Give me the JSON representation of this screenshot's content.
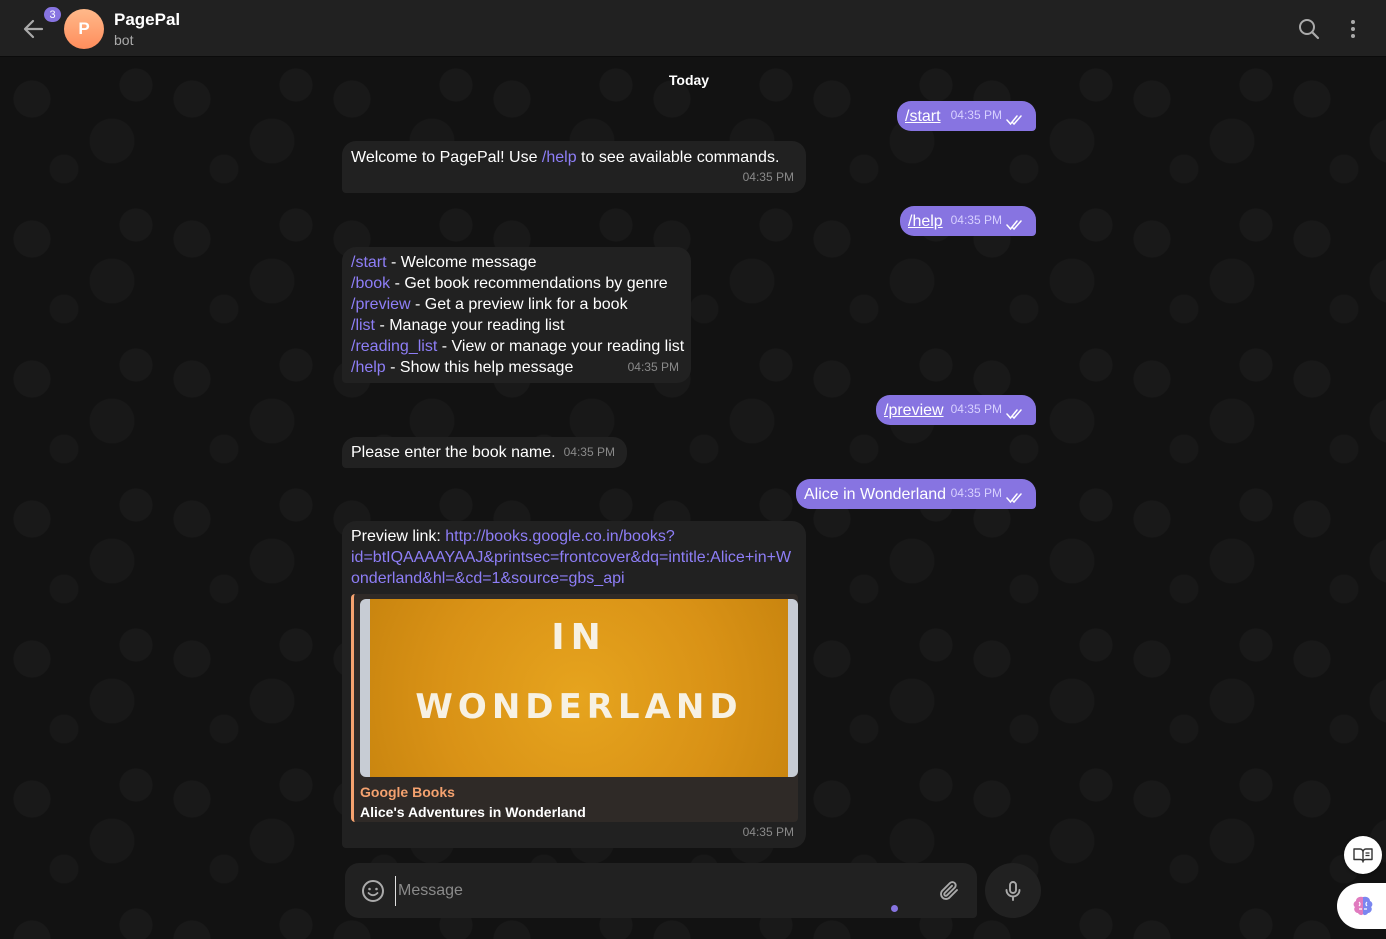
{
  "header": {
    "unread_count": "3",
    "avatar_letter": "P",
    "title": "PagePal",
    "status": "bot"
  },
  "date_separator": "Today",
  "messages": [
    {
      "direction": "out",
      "text": "/start",
      "time": "04:35 PM"
    },
    {
      "direction": "in",
      "prefix": "Welcome to PagePal! Use ",
      "link": "/help",
      "suffix": " to see available commands.",
      "time": "04:35 PM"
    },
    {
      "direction": "out",
      "text": "/help",
      "time": "04:35 PM"
    },
    {
      "direction": "in",
      "help_lines": [
        {
          "cmd": "/start",
          "desc": " - Welcome message"
        },
        {
          "cmd": "/book",
          "desc": " - Get book recommendations by genre"
        },
        {
          "cmd": "/preview",
          "desc": " - Get a preview link for a book"
        },
        {
          "cmd": "/list",
          "desc": " - Manage your reading list"
        },
        {
          "cmd": "/reading_list",
          "desc": " - View or manage your reading list"
        },
        {
          "cmd": "/help",
          "desc": " - Show this help message"
        }
      ],
      "time": "04:35 PM"
    },
    {
      "direction": "out",
      "text": "/preview",
      "time": "04:35 PM"
    },
    {
      "direction": "in",
      "text": "Please enter the book name.",
      "time": "04:35 PM"
    },
    {
      "direction": "out",
      "text": "Alice in Wonderland",
      "time": "04:35 PM"
    },
    {
      "direction": "in",
      "label": "Preview link: ",
      "url_line1": "http://books.google.co.in/books?",
      "url_line2": "id=btIQAAAAYAAJ&printsec=frontcover&dq=intitle:Alice+in+W",
      "url_line3": "onderland&hl=&cd=1&source=gbs_api",
      "preview": {
        "image_line1": "IN",
        "image_line2": "WONDERLAND",
        "site": "Google Books",
        "title": "Alice's Adventures in Wonderland"
      },
      "time": "04:35 PM"
    }
  ],
  "composer": {
    "placeholder": "Message"
  },
  "colors": {
    "accent": "#8774e1",
    "link": "#8e7ef7",
    "preview_accent": "#f5a26f",
    "incoming_bubble": "#212121",
    "header_bg": "#212121"
  },
  "icons": [
    "back-arrow-icon",
    "search-icon",
    "more-vertical-icon",
    "double-check-icon",
    "emoji-icon",
    "paperclip-icon",
    "microphone-icon",
    "book-open-icon",
    "brain-icon"
  ]
}
